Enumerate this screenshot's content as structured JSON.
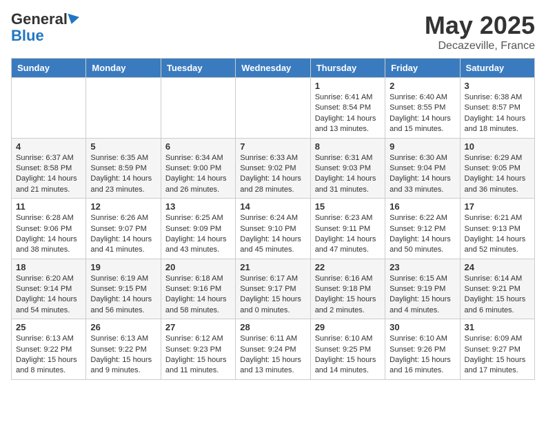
{
  "header": {
    "logo_general": "General",
    "logo_blue": "Blue",
    "month": "May 2025",
    "location": "Decazeville, France"
  },
  "days_of_week": [
    "Sunday",
    "Monday",
    "Tuesday",
    "Wednesday",
    "Thursday",
    "Friday",
    "Saturday"
  ],
  "weeks": [
    [
      {
        "day": "",
        "info": ""
      },
      {
        "day": "",
        "info": ""
      },
      {
        "day": "",
        "info": ""
      },
      {
        "day": "",
        "info": ""
      },
      {
        "day": "1",
        "info": "Sunrise: 6:41 AM\nSunset: 8:54 PM\nDaylight: 14 hours\nand 13 minutes."
      },
      {
        "day": "2",
        "info": "Sunrise: 6:40 AM\nSunset: 8:55 PM\nDaylight: 14 hours\nand 15 minutes."
      },
      {
        "day": "3",
        "info": "Sunrise: 6:38 AM\nSunset: 8:57 PM\nDaylight: 14 hours\nand 18 minutes."
      }
    ],
    [
      {
        "day": "4",
        "info": "Sunrise: 6:37 AM\nSunset: 8:58 PM\nDaylight: 14 hours\nand 21 minutes."
      },
      {
        "day": "5",
        "info": "Sunrise: 6:35 AM\nSunset: 8:59 PM\nDaylight: 14 hours\nand 23 minutes."
      },
      {
        "day": "6",
        "info": "Sunrise: 6:34 AM\nSunset: 9:00 PM\nDaylight: 14 hours\nand 26 minutes."
      },
      {
        "day": "7",
        "info": "Sunrise: 6:33 AM\nSunset: 9:02 PM\nDaylight: 14 hours\nand 28 minutes."
      },
      {
        "day": "8",
        "info": "Sunrise: 6:31 AM\nSunset: 9:03 PM\nDaylight: 14 hours\nand 31 minutes."
      },
      {
        "day": "9",
        "info": "Sunrise: 6:30 AM\nSunset: 9:04 PM\nDaylight: 14 hours\nand 33 minutes."
      },
      {
        "day": "10",
        "info": "Sunrise: 6:29 AM\nSunset: 9:05 PM\nDaylight: 14 hours\nand 36 minutes."
      }
    ],
    [
      {
        "day": "11",
        "info": "Sunrise: 6:28 AM\nSunset: 9:06 PM\nDaylight: 14 hours\nand 38 minutes."
      },
      {
        "day": "12",
        "info": "Sunrise: 6:26 AM\nSunset: 9:07 PM\nDaylight: 14 hours\nand 41 minutes."
      },
      {
        "day": "13",
        "info": "Sunrise: 6:25 AM\nSunset: 9:09 PM\nDaylight: 14 hours\nand 43 minutes."
      },
      {
        "day": "14",
        "info": "Sunrise: 6:24 AM\nSunset: 9:10 PM\nDaylight: 14 hours\nand 45 minutes."
      },
      {
        "day": "15",
        "info": "Sunrise: 6:23 AM\nSunset: 9:11 PM\nDaylight: 14 hours\nand 47 minutes."
      },
      {
        "day": "16",
        "info": "Sunrise: 6:22 AM\nSunset: 9:12 PM\nDaylight: 14 hours\nand 50 minutes."
      },
      {
        "day": "17",
        "info": "Sunrise: 6:21 AM\nSunset: 9:13 PM\nDaylight: 14 hours\nand 52 minutes."
      }
    ],
    [
      {
        "day": "18",
        "info": "Sunrise: 6:20 AM\nSunset: 9:14 PM\nDaylight: 14 hours\nand 54 minutes."
      },
      {
        "day": "19",
        "info": "Sunrise: 6:19 AM\nSunset: 9:15 PM\nDaylight: 14 hours\nand 56 minutes."
      },
      {
        "day": "20",
        "info": "Sunrise: 6:18 AM\nSunset: 9:16 PM\nDaylight: 14 hours\nand 58 minutes."
      },
      {
        "day": "21",
        "info": "Sunrise: 6:17 AM\nSunset: 9:17 PM\nDaylight: 15 hours\nand 0 minutes."
      },
      {
        "day": "22",
        "info": "Sunrise: 6:16 AM\nSunset: 9:18 PM\nDaylight: 15 hours\nand 2 minutes."
      },
      {
        "day": "23",
        "info": "Sunrise: 6:15 AM\nSunset: 9:19 PM\nDaylight: 15 hours\nand 4 minutes."
      },
      {
        "day": "24",
        "info": "Sunrise: 6:14 AM\nSunset: 9:21 PM\nDaylight: 15 hours\nand 6 minutes."
      }
    ],
    [
      {
        "day": "25",
        "info": "Sunrise: 6:13 AM\nSunset: 9:22 PM\nDaylight: 15 hours\nand 8 minutes."
      },
      {
        "day": "26",
        "info": "Sunrise: 6:13 AM\nSunset: 9:22 PM\nDaylight: 15 hours\nand 9 minutes."
      },
      {
        "day": "27",
        "info": "Sunrise: 6:12 AM\nSunset: 9:23 PM\nDaylight: 15 hours\nand 11 minutes."
      },
      {
        "day": "28",
        "info": "Sunrise: 6:11 AM\nSunset: 9:24 PM\nDaylight: 15 hours\nand 13 minutes."
      },
      {
        "day": "29",
        "info": "Sunrise: 6:10 AM\nSunset: 9:25 PM\nDaylight: 15 hours\nand 14 minutes."
      },
      {
        "day": "30",
        "info": "Sunrise: 6:10 AM\nSunset: 9:26 PM\nDaylight: 15 hours\nand 16 minutes."
      },
      {
        "day": "31",
        "info": "Sunrise: 6:09 AM\nSunset: 9:27 PM\nDaylight: 15 hours\nand 17 minutes."
      }
    ]
  ]
}
